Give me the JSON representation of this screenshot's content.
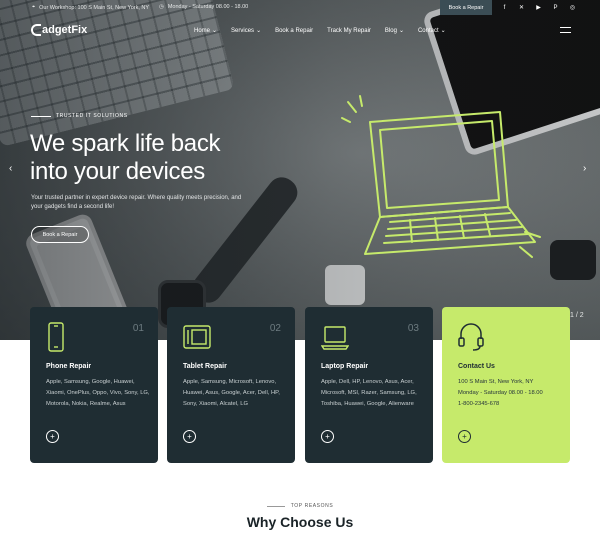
{
  "topbar": {
    "address": "Our Workshop: 100 S Main St, New York, NY",
    "hours": "Monday - Saturday 08.00 - 18.00",
    "book_button": "Book a Repair",
    "socials": [
      "facebook-icon",
      "x-icon",
      "youtube-icon",
      "pinterest-icon",
      "instagram-icon"
    ]
  },
  "brand": {
    "logo_text": "adgetFix"
  },
  "nav": {
    "items": [
      {
        "label": "Home",
        "has_dropdown": true
      },
      {
        "label": "Services",
        "has_dropdown": true
      },
      {
        "label": "Book a Repair",
        "has_dropdown": false
      },
      {
        "label": "Track My Repair",
        "has_dropdown": false
      },
      {
        "label": "Blog",
        "has_dropdown": true
      },
      {
        "label": "Contact",
        "has_dropdown": true
      }
    ]
  },
  "hero": {
    "eyebrow": "TRUSTED IT SOLUTIONS",
    "headline_line1": "We spark life back",
    "headline_line2": "into your devices",
    "subtext": "Your trusted partner in expert device repair. Where quality meets precision, and your gadgets find a second life!",
    "cta": "Book a Repair",
    "pager": "1 / 2"
  },
  "cards": [
    {
      "num": "01",
      "title": "Phone Repair",
      "desc": "Apple, Samsung, Google, Huawei, Xiaomi, OnePlus, Oppo, Vivo, Sony, LG, Motorola, Nokia, Realme, Asus",
      "icon": "phone-icon"
    },
    {
      "num": "02",
      "title": "Tablet Repair",
      "desc": "Apple, Samsung, Microsoft, Lenovo, Huawei, Asus, Google, Acer, Dell, HP, Sony, Xiaomi, Alcatel, LG",
      "icon": "tablet-icon"
    },
    {
      "num": "03",
      "title": "Laptop Repair",
      "desc": "Apple, Dell, HP, Lenovo, Asus, Acer, Microsoft, MSI, Razer, Samsung, LG, Toshiba, Huawei, Google, Alienware",
      "icon": "laptop-icon"
    }
  ],
  "contact_card": {
    "title": "Contact Us",
    "address": "100 S Main St, New York, NY",
    "hours": "Monday - Saturday 08.00 - 18.00",
    "phone": "1-800-2345-678",
    "icon": "headset-icon"
  },
  "why": {
    "eyebrow": "TOP REASONS",
    "title": "Why Choose Us"
  },
  "colors": {
    "accent_lime": "#c6ea6b",
    "card_dark": "#1f2d33",
    "topbar_button": "#3b4d55"
  }
}
